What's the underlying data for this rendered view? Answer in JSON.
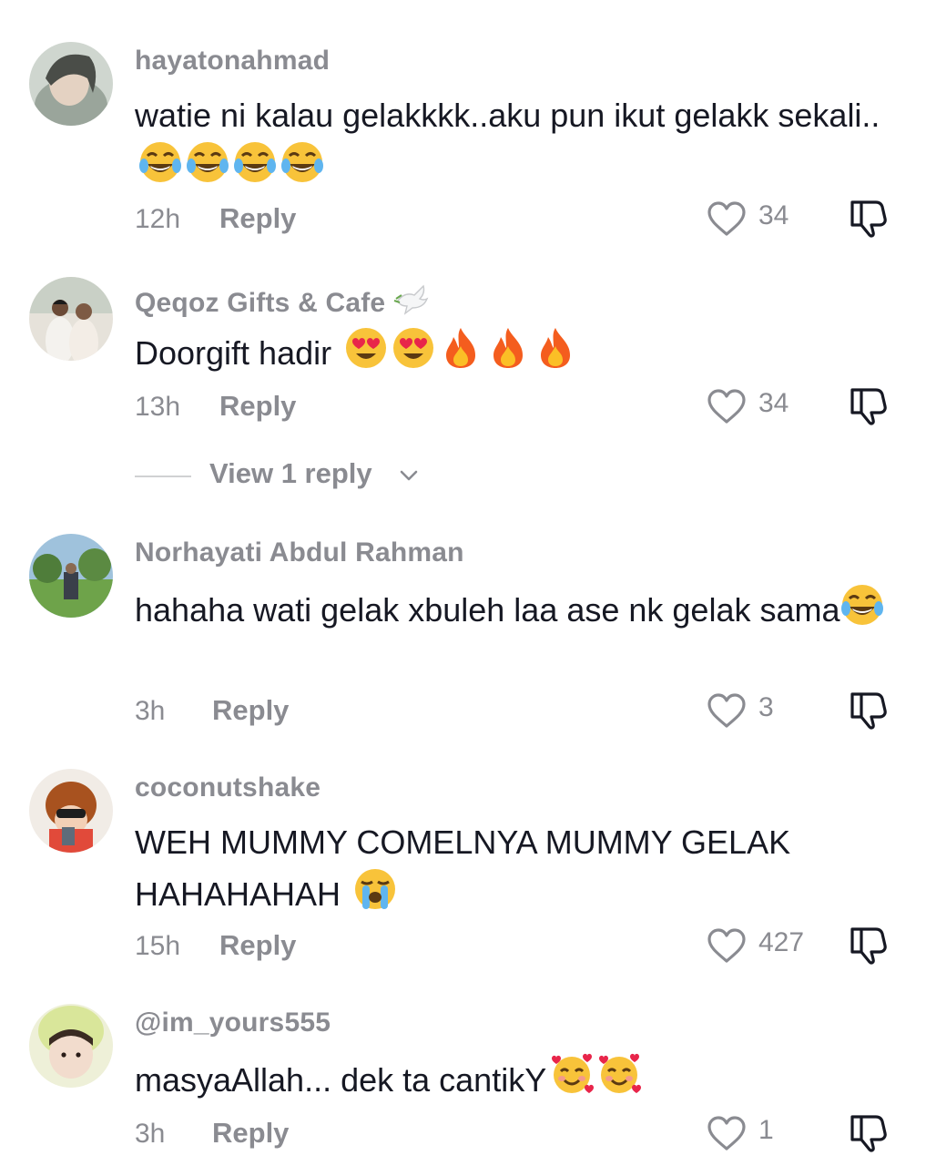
{
  "comments": [
    {
      "username": "hayatonahmad",
      "text": "watie ni kalau gelakkkk..aku pun ikut gelakk sekali..",
      "emojis": [
        "tears-of-joy",
        "tears-of-joy",
        "tears-of-joy",
        "tears-of-joy"
      ],
      "time": "12h",
      "reply_label": "Reply",
      "likes": "34"
    },
    {
      "username": "Qeqoz Gifts & Cafe",
      "username_badge": "dove-icon",
      "text": "Doorgift hadir ",
      "emojis": [
        "heart-eyes",
        "heart-eyes",
        "fire",
        "fire",
        "fire"
      ],
      "time": "13h",
      "reply_label": "Reply",
      "likes": "34",
      "view_replies": "View 1 reply"
    },
    {
      "username": "Norhayati Abdul Rahman",
      "text": "hahaha wati gelak xbuleh laa ase nk gelak sama",
      "emojis": [
        "tears-of-joy"
      ],
      "time": "3h",
      "reply_label": "Reply",
      "likes": "3"
    },
    {
      "username": "coconutshake",
      "text": "WEH MUMMY COMELNYA MUMMY GELAK HAHAHAHAH ",
      "emojis": [
        "loudly-crying"
      ],
      "time": "15h",
      "reply_label": "Reply",
      "likes": "427"
    },
    {
      "username": "@im_yours555",
      "text": "masyaAllah... dek ta cantikY",
      "emojis": [
        "smiling-with-hearts",
        "smiling-with-hearts"
      ],
      "time": "3h",
      "reply_label": "Reply",
      "likes": "1"
    }
  ],
  "colors": {
    "text": "#161823",
    "secondary": "#8a8b91",
    "background": "#ffffff"
  }
}
